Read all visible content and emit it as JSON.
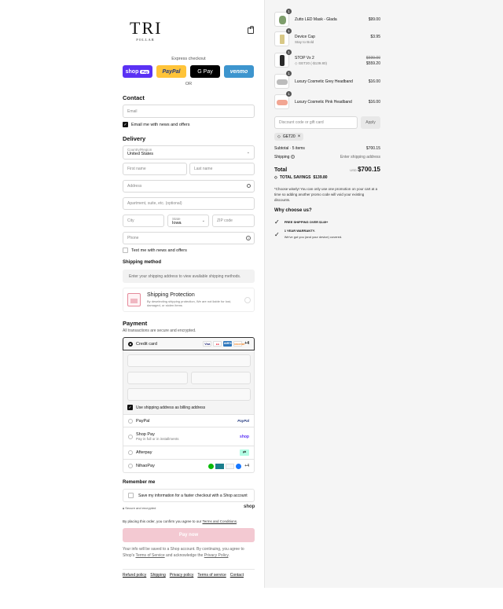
{
  "brand": {
    "name": "TRI",
    "sub": "POLLAR"
  },
  "express": {
    "label": "Express checkout",
    "shop": "shop",
    "shop_pay": "Pay",
    "paypal": "PayPal",
    "gpay": "G Pay",
    "venmo": "venmo",
    "or": "OR"
  },
  "contact": {
    "heading": "Contact",
    "email_placeholder": "Email",
    "news_label": "Email me with news and offers"
  },
  "delivery": {
    "heading": "Delivery",
    "country_label": "Country/Region",
    "country_value": "United States",
    "first_name": "First name",
    "last_name": "Last name",
    "address": "Address",
    "apartment": "Apartment, suite, etc. (optional)",
    "city": "City",
    "state_label": "State",
    "state_value": "Iowa",
    "zip": "ZIP code",
    "phone": "Phone",
    "text_news": "Text me with news and offers"
  },
  "shipping": {
    "heading": "Shipping method",
    "info": "Enter your shipping address to view available shipping methods."
  },
  "protection": {
    "title": "Shipping Protection",
    "desc": "By deselecting shipping protection, We are not liable for lost, damaged, or stolen items"
  },
  "payment": {
    "heading": "Payment",
    "sub": "All transactions are secure and encrypted.",
    "credit_card": "Credit card",
    "card_brands": [
      "Visa",
      "MC",
      "AMEX",
      "DISCOVER"
    ],
    "more": "+4",
    "billing_same": "Use shipping address as billing address",
    "paypal": "PayPal",
    "paypal_logo": "PayPal",
    "shoppay": "Shop Pay",
    "shoppay_sub": "Pay in full or in installments",
    "shoppay_logo": "shop",
    "afterpay": "Afterpay",
    "nihaopay": "NihaoPay",
    "nihao_more": "+4"
  },
  "remember": {
    "heading": "Remember me",
    "save_label": "Save my information for a faster checkout with a Shop account",
    "secure": "Secure and encrypted",
    "shop": "shop"
  },
  "terms": {
    "prefix": "By placing this order, you confirm you agree to our ",
    "link": "Terms and Conditions",
    "suffix": "."
  },
  "pay_now": "Pay now",
  "shop_note": {
    "a": "Your info will be saved to a Shop account. By continuing, you agree to Shop's ",
    "tos": "Terms of Service",
    "b": " and acknowledge the ",
    "privacy": "Privacy Policy",
    "c": "."
  },
  "footer_links": [
    "Refund policy",
    "Shipping",
    "Privacy policy",
    "Terms of service",
    "Contact"
  ],
  "cart": {
    "items": [
      {
        "qty": "1",
        "name": "Zutto LED Mask - Glada",
        "sub": "",
        "price": "$99.00",
        "old_price": "",
        "color": "#6a8f5a"
      },
      {
        "qty": "1",
        "name": "Device Cap",
        "sub": "Stay to Bold",
        "price": "$3.95",
        "old_price": "",
        "color": "#c8b36a"
      },
      {
        "qty": "1",
        "name": "STOP Vx 2",
        "sub": "GET20 (-$139.80)",
        "price": "$559.20",
        "old_price": "$699.00",
        "color": "#333333"
      },
      {
        "qty": "1",
        "name": "Luxury Cosmetic Grey Headband",
        "sub": "",
        "price": "$16.00",
        "old_price": "",
        "color": "#bdbdbd"
      },
      {
        "qty": "1",
        "name": "Luxury Cosmetic Pink Headband",
        "sub": "",
        "price": "$16.00",
        "old_price": "",
        "color": "#f0a898"
      }
    ],
    "discount_placeholder": "Discount code or gift card",
    "apply": "Apply",
    "code": "GET20",
    "subtotal_label": "Subtotal · 5 items",
    "subtotal": "$700.15",
    "shipping_label": "Shipping",
    "shipping_value": "Enter shipping address",
    "total_label": "Total",
    "currency": "USD",
    "total": "$700.15",
    "savings_label": "TOTAL SAVINGS",
    "savings": "$139.80",
    "promo_note": "*Choose wisely! You can only use one promotion on your cart at a time so adding another promo code will void your existing discounts.",
    "why": "Why choose us?",
    "reason1": "FREE SHIPPING OVER $149+",
    "reason2_title": "1 YEAR WARRANTY.",
    "reason2_sub": "We've got you (and your device) covered."
  }
}
